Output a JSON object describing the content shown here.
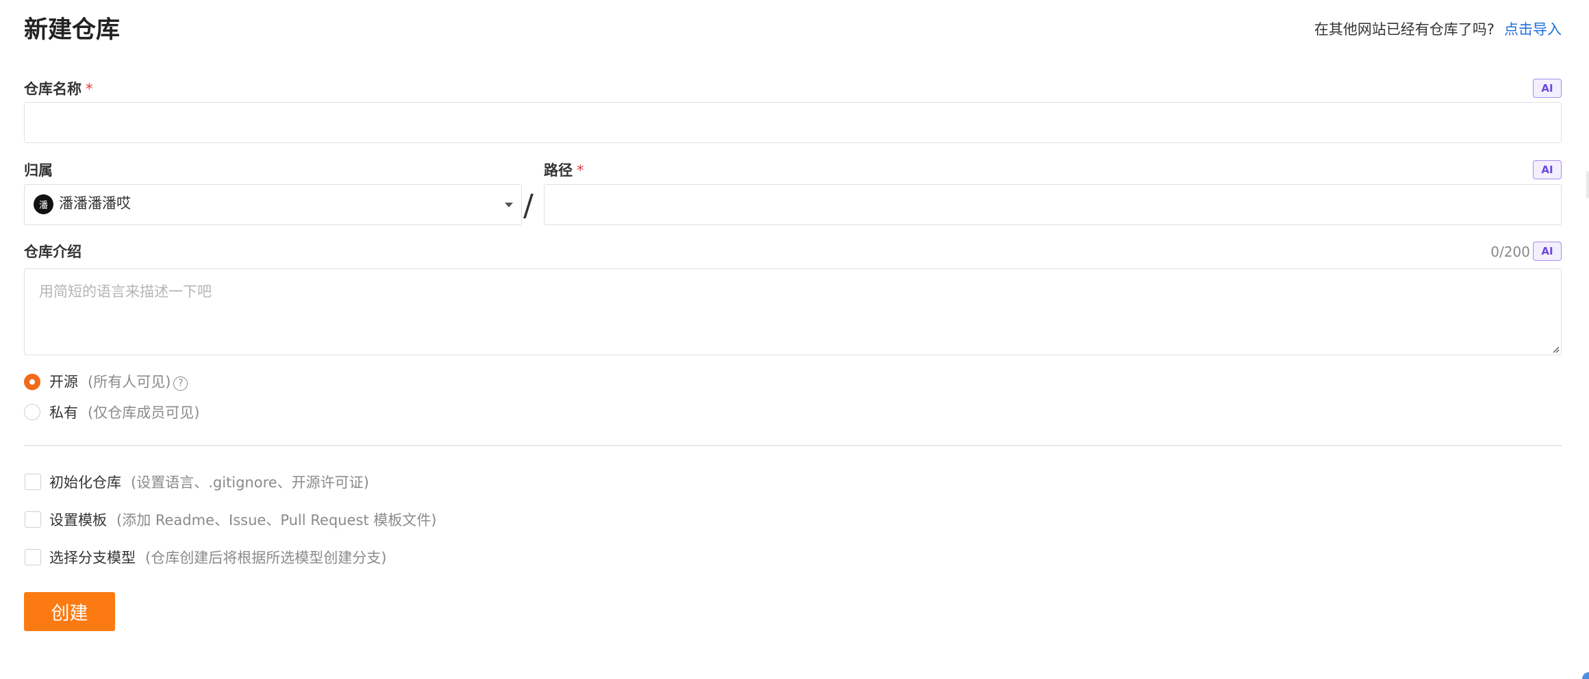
{
  "page": {
    "title": "新建仓库",
    "import_hint": "在其他网站已经有仓库了吗?",
    "import_link": "点击导入"
  },
  "repo_name": {
    "label": "仓库名称",
    "required_mark": "*",
    "ai_badge": "AI",
    "value": ""
  },
  "owner": {
    "label": "归属",
    "avatar_text": "潘",
    "selected": "潘潘潘潘哎"
  },
  "separator": "/",
  "path": {
    "label": "路径",
    "required_mark": "*",
    "ai_badge": "AI",
    "value": ""
  },
  "description": {
    "label": "仓库介绍",
    "counter": "0/200",
    "ai_badge": "AI",
    "placeholder": "用简短的语言来描述一下吧"
  },
  "visibility": {
    "selected": "public",
    "options": [
      {
        "label": "开源",
        "hint": "(所有人可见)",
        "help_icon": "?"
      },
      {
        "label": "私有",
        "hint": "(仅仓库成员可见)"
      }
    ]
  },
  "extras": [
    {
      "label": "初始化仓库",
      "hint": "(设置语言、.gitignore、开源许可证)",
      "checked": false
    },
    {
      "label": "设置模板",
      "hint": "(添加 Readme、Issue、Pull Request 模板文件)",
      "checked": false
    },
    {
      "label": "选择分支模型",
      "hint": "(仓库创建后将根据所选模型创建分支)",
      "checked": false
    }
  ],
  "actions": {
    "create": "创建"
  },
  "colors": {
    "accent": "#fb7b12",
    "link": "#1e6fd9",
    "ai_badge": "#6c47e0",
    "required": "#e53935"
  }
}
